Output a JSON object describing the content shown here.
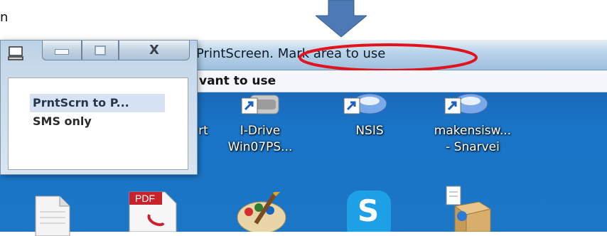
{
  "edge_text": "n",
  "caption": {
    "title": "PrintScreen. Mark area to use",
    "highlight_color": "#e0141e"
  },
  "info_bar": {
    "text": "vant to use"
  },
  "mini_window": {
    "buttons": {
      "close_label": "X"
    },
    "items": [
      "PrntScrn to P...",
      "SMS only"
    ]
  },
  "desktop": {
    "icons": [
      {
        "id": "partial",
        "label_line1": "rt",
        "label_line2": ""
      },
      {
        "id": "idrive",
        "label_line1": "I-Drive",
        "label_line2": "Win07PS..."
      },
      {
        "id": "nsis",
        "label_line1": "NSIS",
        "label_line2": ""
      },
      {
        "id": "makensis",
        "label_line1": "makensisw...",
        "label_line2": "- Snarvei"
      }
    ],
    "bottom_icons": [
      {
        "name": "text-file-icon"
      },
      {
        "name": "pdf-file-icon",
        "badge": "PDF"
      },
      {
        "name": "paint-palette-icon"
      },
      {
        "name": "skype-icon",
        "letter": "S"
      },
      {
        "name": "installer-box-icon"
      }
    ]
  },
  "colors": {
    "arrow": "#4d79b4",
    "desktop": "#1a74c7"
  }
}
